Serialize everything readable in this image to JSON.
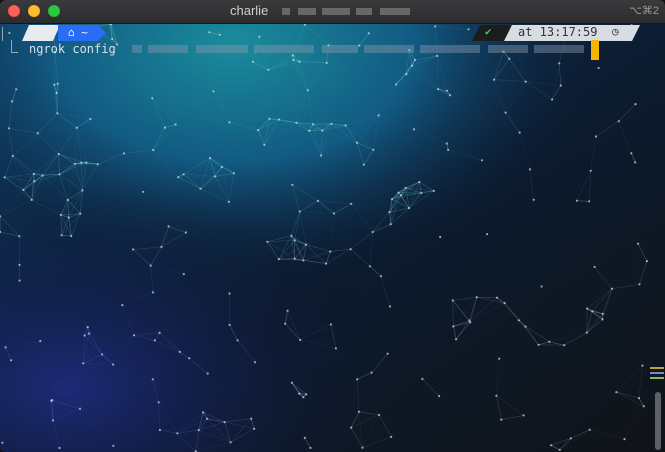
{
  "window": {
    "title": "charlie",
    "shortcut": "⌥⌘2"
  },
  "prompt": {
    "os_icon": "apple-icon",
    "os_glyph": "",
    "dir_icon": "home-icon",
    "dir_text": "⌂ ~",
    "status_icon": "checkmark-icon",
    "status_glyph": "✔",
    "time_text": "at 13:17:59",
    "clock_icon": "clock-icon",
    "clock_glyph": "◷"
  },
  "command": {
    "text": "ngrok config"
  },
  "colors": {
    "dir_segment": "#2b6cf6",
    "cursor": "#f4b400",
    "status_ok": "#3ec45a",
    "time_segment": "#d8dde3"
  }
}
